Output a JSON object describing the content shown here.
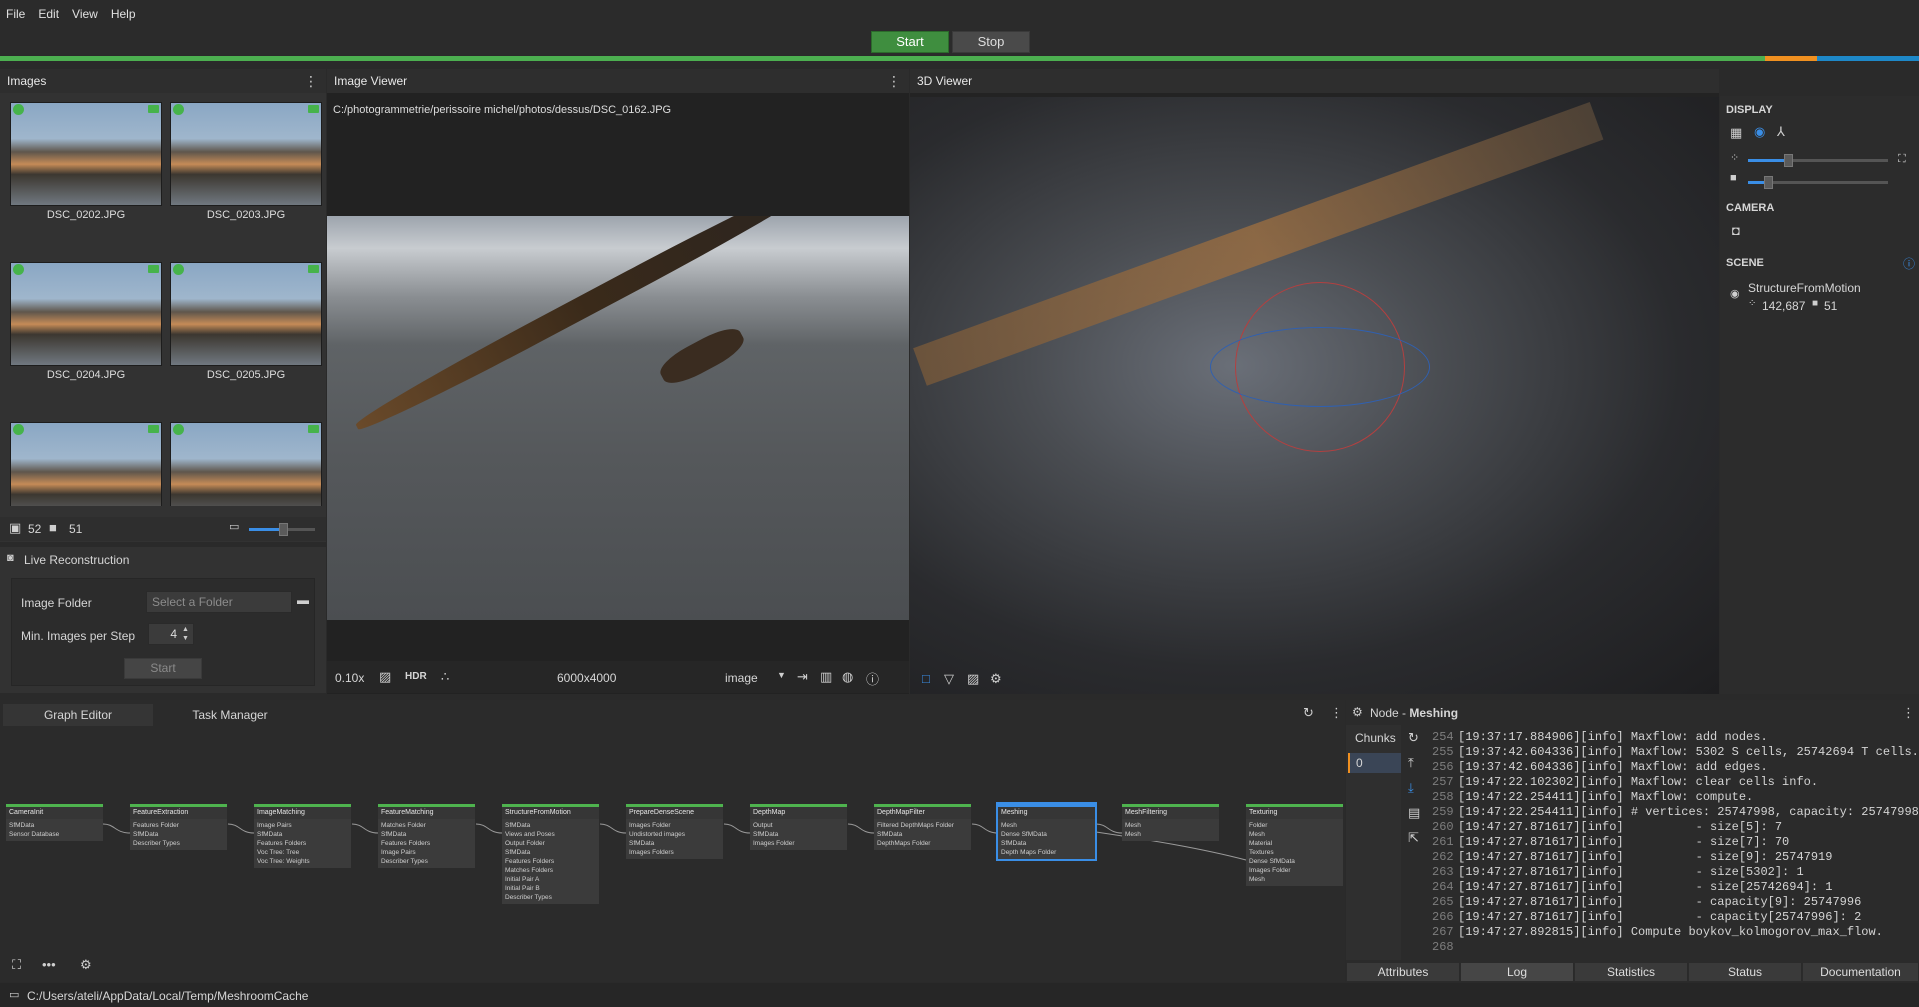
{
  "menu": [
    "File",
    "Edit",
    "View",
    "Help"
  ],
  "toolbar": {
    "start": "Start",
    "stop": "Stop"
  },
  "progress_colors": {
    "done": "#4caf50",
    "running": "#f09020",
    "pending": "#1e88c8"
  },
  "images_panel": {
    "title": "Images",
    "thumbs": [
      "DSC_0202.JPG",
      "DSC_0203.JPG",
      "DSC_0204.JPG",
      "DSC_0205.JPG"
    ],
    "image_count": "52",
    "camera_count": "51"
  },
  "live": {
    "title": "Live Reconstruction",
    "folder_label": "Image Folder",
    "folder_placeholder": "Select a Folder",
    "min_label": "Min. Images per Step",
    "min_value": "4",
    "start": "Start"
  },
  "viewer": {
    "title": "Image Viewer",
    "path": "C:/photogrammetrie/perissoire michel/photos/dessus/DSC_0162.JPG",
    "zoom": "0.10x",
    "hdr": "HDR",
    "resolution": "6000x4000",
    "mode": "image"
  },
  "viewer3d": {
    "title": "3D Viewer"
  },
  "display": {
    "display_title": "DISPLAY",
    "camera_title": "CAMERA",
    "scene_title": "SCENE",
    "scene_item": "StructureFromMotion",
    "points": "142,687",
    "cameras": "51"
  },
  "graph": {
    "tab1": "Graph Editor",
    "tab2": "Task Manager",
    "nodes": [
      {
        "name": "CameraInit",
        "ports": [
          "SfMData",
          "Sensor Database"
        ]
      },
      {
        "name": "FeatureExtraction",
        "ports": [
          "Features Folder",
          "SfMData",
          "Describer Types"
        ]
      },
      {
        "name": "ImageMatching",
        "ports": [
          "Image Pairs",
          "SfMData",
          "Features Folders",
          "Voc Tree: Tree",
          "Voc Tree: Weights"
        ]
      },
      {
        "name": "FeatureMatching",
        "ports": [
          "Matches Folder",
          "SfMData",
          "Features Folders",
          "Image Pairs",
          "Describer Types"
        ]
      },
      {
        "name": "StructureFromMotion",
        "ports": [
          "SfMData",
          "Views and Poses",
          "Output Folder",
          "SfMData",
          "Features Folders",
          "Matches Folders",
          "Initial Pair A",
          "Initial Pair B",
          "Describer Types"
        ]
      },
      {
        "name": "PrepareDenseScene",
        "ports": [
          "Images Folder",
          "Undistorted images",
          "SfMData",
          "Images Folders"
        ]
      },
      {
        "name": "DepthMap",
        "ports": [
          "Output",
          "SfMData",
          "Images Folder"
        ]
      },
      {
        "name": "DepthMapFilter",
        "ports": [
          "Filtered DepthMaps Folder",
          "SfMData",
          "DepthMaps Folder"
        ]
      },
      {
        "name": "Meshing",
        "ports": [
          "Mesh",
          "Dense SfMData",
          "SfMData",
          "Depth Maps Folder"
        ]
      },
      {
        "name": "MeshFiltering",
        "ports": [
          "Mesh",
          "Mesh"
        ]
      },
      {
        "name": "Texturing",
        "ports": [
          "Folder",
          "Mesh",
          "Material",
          "Textures",
          "Dense SfMData",
          "Images Folder",
          "Mesh"
        ]
      }
    ]
  },
  "node_panel": {
    "title_prefix": "Node - ",
    "title": "Meshing",
    "chunks_label": "Chunks",
    "chunk_value": "0",
    "log": [
      {
        "n": "254",
        "t": "[19:37:17.884906][info] Maxflow: add nodes."
      },
      {
        "n": "255",
        "t": "[19:37:42.604336][info] Maxflow: 5302 S cells, 25742694 T cells."
      },
      {
        "n": "256",
        "t": "[19:37:42.604336][info] Maxflow: add edges."
      },
      {
        "n": "257",
        "t": "[19:47:22.102302][info] Maxflow: clear cells info."
      },
      {
        "n": "258",
        "t": "[19:47:22.254411][info] Maxflow: compute."
      },
      {
        "n": "259",
        "t": "[19:47:22.254411][info] # vertices: 25747998, capacity: 25747998"
      },
      {
        "n": "260",
        "t": "[19:47:27.871617][info]          - size[5]: 7"
      },
      {
        "n": "261",
        "t": "[19:47:27.871617][info]          - size[7]: 70"
      },
      {
        "n": "262",
        "t": "[19:47:27.871617][info]          - size[9]: 25747919"
      },
      {
        "n": "263",
        "t": "[19:47:27.871617][info]          - size[5302]: 1"
      },
      {
        "n": "264",
        "t": "[19:47:27.871617][info]          - size[25742694]: 1"
      },
      {
        "n": "265",
        "t": "[19:47:27.871617][info]          - capacity[9]: 25747996"
      },
      {
        "n": "266",
        "t": "[19:47:27.871617][info]          - capacity[25747996]: 2"
      },
      {
        "n": "267",
        "t": "[19:47:27.892815][info] Compute boykov_kolmogorov_max_flow."
      },
      {
        "n": "268",
        "t": ""
      }
    ],
    "tabs": [
      "Attributes",
      "Log",
      "Statistics",
      "Status",
      "Documentation"
    ]
  },
  "statusbar": {
    "path": "C:/Users/ateli/AppData/Local/Temp/MeshroomCache"
  }
}
